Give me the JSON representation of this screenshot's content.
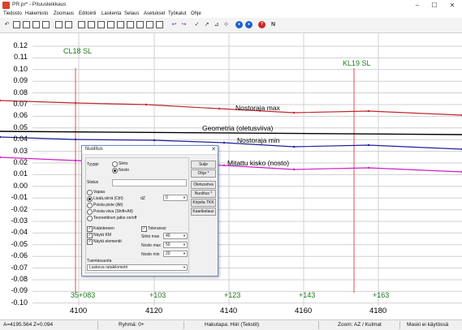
{
  "window": {
    "title": "PR.pr* - Pituusleikkaus",
    "controls": [
      "–",
      "☐",
      "✕"
    ]
  },
  "menu": [
    "Tiedosto",
    "Hakemisto",
    "Zoomaus",
    "Editointi",
    "Laskenta",
    "Selaus",
    "Asetukset",
    "Työkalut",
    "Ohje"
  ],
  "toolbar": {
    "icons": [
      "undo-arrow-icon",
      "new-file-icon",
      "open-file-icon",
      "save-file-icon",
      "copy-icon",
      "paste-icon",
      "print-icon",
      "print-preview-icon",
      "zoom-window-icon",
      "zoom-in-icon",
      "zoom-out-icon",
      "zoom-all-icon",
      "zoom-previous-icon",
      "zoom-next-icon",
      "undo-icon",
      "redo-icon",
      "measure-icon",
      "draw-line-icon",
      "select-icon",
      "point-icon",
      "info-circle-icon",
      "link-circle-icon",
      "help-icon",
      "north-icon"
    ],
    "north_label": "N"
  },
  "plot": {
    "y_ticks": [
      "0.12",
      "0.11",
      "0.10",
      "0.09",
      "0.08",
      "0.07",
      "0.06",
      "0.05",
      "0.04",
      "0.03",
      "0.02",
      "0.01",
      "0.00",
      "-0.01",
      "-0.02",
      "-0.03",
      "-0.04",
      "-0.05",
      "-0.06",
      "-0.07",
      "-0.08",
      "-0.09",
      "-0.10"
    ],
    "x_ticks": [
      "4100",
      "4120",
      "4140",
      "4160",
      "4180"
    ],
    "stations": [
      "35+083",
      "+103",
      "+123",
      "+143",
      "+163"
    ],
    "markers": [
      "CL18 SL",
      "KL19 SL"
    ],
    "lines": {
      "upper": "Nostoraja max",
      "geometry": "Geometria (oletusviiva)",
      "lower": "Nostoraja min",
      "measured": "Mitattu kisko (nosto)"
    },
    "colors": {
      "upper": "#c1272d",
      "geometry": "#000000",
      "lower": "#1f1f9e",
      "measured": "#d01cc8",
      "marker": "#e05050",
      "grid": "#d0d0d0",
      "station_text": "#1a7a1a"
    }
  },
  "dialog": {
    "title": "Nuolitus",
    "close": "✕",
    "type_label": "Tyyppi",
    "type_options": [
      "Siirto",
      "Nosto"
    ],
    "type_selected": "Nosto",
    "status_label": "Status",
    "status_value": "",
    "radio_options": [
      "Vapaa",
      "Lisää,siirrä  (Ctrl)",
      "Poista piste  (Alt)",
      "Poista viiva  (Shift+Alt)",
      "Teoreettinen jatke on/off"
    ],
    "radio_selected": "Lisää,siirrä  (Ctrl)",
    "dz_label": "dZ",
    "dz_value": "0",
    "checkboxes_left": [
      "Kääntereen",
      "Näytä KM",
      "Näytä elementit"
    ],
    "tolerance_label": "Toleranssi",
    "siirto_max_label": "Siirto max",
    "siirto_max_value": "40",
    "nosto_max_label": "Nosto max",
    "nosto_max_value": "50",
    "nosto_min_label": "Nosto min",
    "nosto_min_value": "20",
    "direction_label": "Tuentasuunta",
    "direction_value": "Laskeva ratakilometri",
    "buttons": [
      "Sulje",
      "Ohje *",
      "Oletusviiva",
      "Nuolitus *",
      "Kirjoita TKK",
      "Kaarikelaus"
    ]
  },
  "status": {
    "coords": "A=4195.564  Z=0.094",
    "group": "Ryhmä: 0+",
    "snap": "Hakutapa: Hiiri (Tekstit)",
    "zoom": "Zoom: AZ  /  Kulmat",
    "mask": "Maski ei käytössä"
  }
}
